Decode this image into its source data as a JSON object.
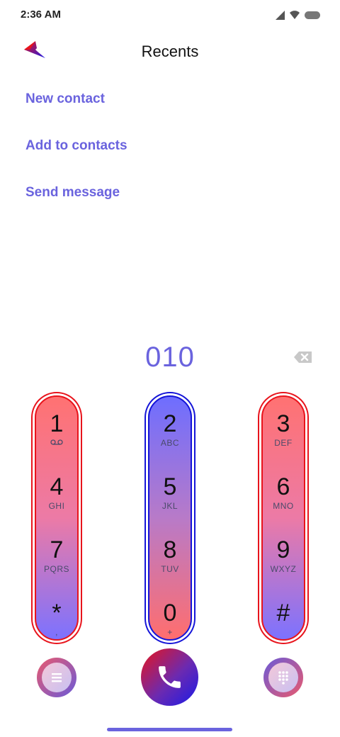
{
  "status_bar": {
    "time": "2:36 AM"
  },
  "header": {
    "title": "Recents"
  },
  "menu": {
    "items": [
      {
        "label": "New contact"
      },
      {
        "label": "Add to contacts"
      },
      {
        "label": "Send message"
      }
    ]
  },
  "dialer": {
    "number": "010",
    "columns": [
      {
        "keys": [
          {
            "digit": "1",
            "letters": ""
          },
          {
            "digit": "4",
            "letters": "GHI"
          },
          {
            "digit": "7",
            "letters": "PQRS"
          },
          {
            "digit": "*",
            "letters": ","
          }
        ]
      },
      {
        "keys": [
          {
            "digit": "2",
            "letters": "ABC"
          },
          {
            "digit": "5",
            "letters": "JKL"
          },
          {
            "digit": "8",
            "letters": "TUV"
          },
          {
            "digit": "0",
            "letters": "+"
          }
        ]
      },
      {
        "keys": [
          {
            "digit": "3",
            "letters": "DEF"
          },
          {
            "digit": "6",
            "letters": "MNO"
          },
          {
            "digit": "9",
            "letters": "WXYZ"
          },
          {
            "digit": "#",
            "letters": ""
          }
        ]
      }
    ]
  },
  "colors": {
    "accent": "#6a63de",
    "red": "#e8141c",
    "blue": "#1515d8"
  },
  "icons": {
    "back": "back-chevron-icon",
    "backspace": "backspace-icon",
    "voicemail": "voicemail-icon",
    "call": "phone-icon",
    "menu": "menu-icon",
    "dialpad": "dialpad-icon"
  }
}
